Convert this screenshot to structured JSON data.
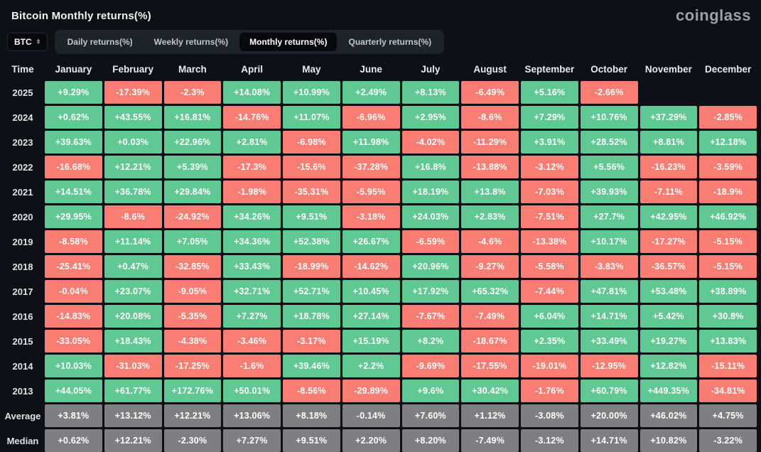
{
  "page": {
    "title": "Bitcoin Monthly returns(%)",
    "logo": "coinglass"
  },
  "controls": {
    "coin_selector": {
      "value": "BTC"
    },
    "tabs": [
      {
        "label": "Daily returns(%)",
        "active": false
      },
      {
        "label": "Weekly returns(%)",
        "active": false
      },
      {
        "label": "Monthly returns(%)",
        "active": true
      },
      {
        "label": "Quarterly returns(%)",
        "active": false
      }
    ]
  },
  "colors": {
    "positive": "#5fc893",
    "negative": "#f97d72",
    "summary": "#7e7f82",
    "background": "#0d1016"
  },
  "chart_data": {
    "type": "heatmap",
    "title": "Bitcoin Monthly returns(%)",
    "columns": [
      "Time",
      "January",
      "February",
      "March",
      "April",
      "May",
      "June",
      "July",
      "August",
      "September",
      "October",
      "November",
      "December"
    ],
    "rows": [
      {
        "label": "2025",
        "type": "year",
        "values": [
          "+9.29%",
          "-17.39%",
          "-2.3%",
          "+14.08%",
          "+10.99%",
          "+2.49%",
          "+8.13%",
          "-6.49%",
          "+5.16%",
          "-2.66%",
          "",
          ""
        ]
      },
      {
        "label": "2024",
        "type": "year",
        "values": [
          "+0.62%",
          "+43.55%",
          "+16.81%",
          "-14.76%",
          "+11.07%",
          "-6.96%",
          "+2.95%",
          "-8.6%",
          "+7.29%",
          "+10.76%",
          "+37.29%",
          "-2.85%"
        ]
      },
      {
        "label": "2023",
        "type": "year",
        "values": [
          "+39.63%",
          "+0.03%",
          "+22.96%",
          "+2.81%",
          "-6.98%",
          "+11.98%",
          "-4.02%",
          "-11.29%",
          "+3.91%",
          "+28.52%",
          "+8.81%",
          "+12.18%"
        ]
      },
      {
        "label": "2022",
        "type": "year",
        "values": [
          "-16.68%",
          "+12.21%",
          "+5.39%",
          "-17.3%",
          "-15.6%",
          "-37.28%",
          "+16.8%",
          "-13.88%",
          "-3.12%",
          "+5.56%",
          "-16.23%",
          "-3.59%"
        ]
      },
      {
        "label": "2021",
        "type": "year",
        "values": [
          "+14.51%",
          "+36.78%",
          "+29.84%",
          "-1.98%",
          "-35.31%",
          "-5.95%",
          "+18.19%",
          "+13.8%",
          "-7.03%",
          "+39.93%",
          "-7.11%",
          "-18.9%"
        ]
      },
      {
        "label": "2020",
        "type": "year",
        "values": [
          "+29.95%",
          "-8.6%",
          "-24.92%",
          "+34.26%",
          "+9.51%",
          "-3.18%",
          "+24.03%",
          "+2.83%",
          "-7.51%",
          "+27.7%",
          "+42.95%",
          "+46.92%"
        ]
      },
      {
        "label": "2019",
        "type": "year",
        "values": [
          "-8.58%",
          "+11.14%",
          "+7.05%",
          "+34.36%",
          "+52.38%",
          "+26.67%",
          "-6.59%",
          "-4.6%",
          "-13.38%",
          "+10.17%",
          "-17.27%",
          "-5.15%"
        ]
      },
      {
        "label": "2018",
        "type": "year",
        "values": [
          "-25.41%",
          "+0.47%",
          "-32.85%",
          "+33.43%",
          "-18.99%",
          "-14.62%",
          "+20.96%",
          "-9.27%",
          "-5.58%",
          "-3.83%",
          "-36.57%",
          "-5.15%"
        ]
      },
      {
        "label": "2017",
        "type": "year",
        "values": [
          "-0.04%",
          "+23.07%",
          "-9.05%",
          "+32.71%",
          "+52.71%",
          "+10.45%",
          "+17.92%",
          "+65.32%",
          "-7.44%",
          "+47.81%",
          "+53.48%",
          "+38.89%"
        ]
      },
      {
        "label": "2016",
        "type": "year",
        "values": [
          "-14.83%",
          "+20.08%",
          "-5.35%",
          "+7.27%",
          "+18.78%",
          "+27.14%",
          "-7.67%",
          "-7.49%",
          "+6.04%",
          "+14.71%",
          "+5.42%",
          "+30.8%"
        ]
      },
      {
        "label": "2015",
        "type": "year",
        "values": [
          "-33.05%",
          "+18.43%",
          "-4.38%",
          "-3.46%",
          "-3.17%",
          "+15.19%",
          "+8.2%",
          "-18.67%",
          "+2.35%",
          "+33.49%",
          "+19.27%",
          "+13.83%"
        ]
      },
      {
        "label": "2014",
        "type": "year",
        "values": [
          "+10.03%",
          "-31.03%",
          "-17.25%",
          "-1.6%",
          "+39.46%",
          "+2.2%",
          "-9.69%",
          "-17.55%",
          "-19.01%",
          "-12.95%",
          "+12.82%",
          "-15.11%"
        ]
      },
      {
        "label": "2013",
        "type": "year",
        "values": [
          "+44.05%",
          "+61.77%",
          "+172.76%",
          "+50.01%",
          "-8.56%",
          "-29.89%",
          "+9.6%",
          "+30.42%",
          "-1.76%",
          "+60.79%",
          "+449.35%",
          "-34.81%"
        ]
      },
      {
        "label": "Average",
        "type": "summary",
        "values": [
          "+3.81%",
          "+13.12%",
          "+12.21%",
          "+13.06%",
          "+8.18%",
          "-0.14%",
          "+7.60%",
          "+1.12%",
          "-3.08%",
          "+20.00%",
          "+46.02%",
          "+4.75%"
        ]
      },
      {
        "label": "Median",
        "type": "summary",
        "values": [
          "+0.62%",
          "+12.21%",
          "-2.30%",
          "+7.27%",
          "+9.51%",
          "+2.20%",
          "+8.20%",
          "-7.49%",
          "-3.12%",
          "+14.71%",
          "+10.82%",
          "-3.22%"
        ]
      }
    ]
  }
}
